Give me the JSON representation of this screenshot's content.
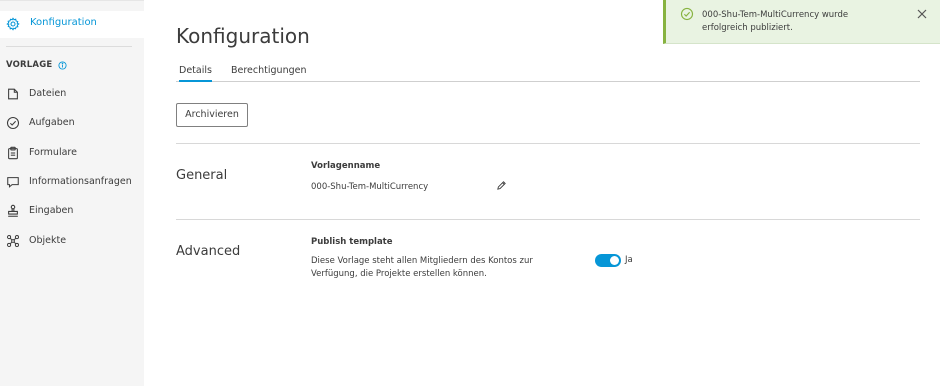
{
  "sidebar": {
    "active": {
      "label": "Konfiguration",
      "icon": "gear-icon"
    },
    "section_title": "VORLAGE",
    "items": [
      {
        "label": "Dateien",
        "icon": "file-icon"
      },
      {
        "label": "Aufgaben",
        "icon": "check-circle-icon"
      },
      {
        "label": "Formulare",
        "icon": "clipboard-icon"
      },
      {
        "label": "Informationsanfragen",
        "icon": "chat-bubble-icon"
      },
      {
        "label": "Eingaben",
        "icon": "stamp-icon"
      },
      {
        "label": "Objekte",
        "icon": "cube-network-icon"
      }
    ]
  },
  "main": {
    "title": "Konfiguration",
    "tabs": [
      {
        "label": "Details",
        "active": true
      },
      {
        "label": "Berechtigungen",
        "active": false
      }
    ],
    "archive_button": "Archivieren",
    "general": {
      "heading": "General",
      "field_label": "Vorlagenname",
      "field_value": "000-Shu-Tem-MultiCurrency"
    },
    "advanced": {
      "heading": "Advanced",
      "field_label": "Publish template",
      "description": "Diese Vorlage steht allen Mitgliedern des Kontos zur Verfügung, die Projekte erstellen können.",
      "toggle_on": true,
      "toggle_label": "Ja"
    }
  },
  "toast": {
    "message": "000-Shu-Tem-MultiCurrency wurde erfolgreich publiziert.",
    "status": "success"
  },
  "colors": {
    "accent": "#0696d7",
    "success": "#87b340",
    "toast_bg": "#e9f3e2",
    "sidebar_bg": "#f5f5f5"
  }
}
